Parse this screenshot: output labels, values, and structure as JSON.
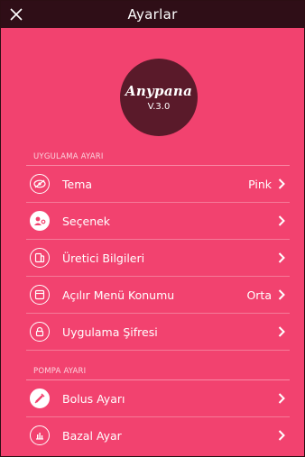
{
  "header": {
    "title": "Ayarlar"
  },
  "logo": {
    "brand": "Anypana",
    "version": "V.3.0"
  },
  "sections": [
    {
      "title": "UYGULAMA AYARI",
      "items": [
        {
          "label": "Tema",
          "value": "Pink",
          "icon": "eye-slash-icon"
        },
        {
          "label": "Seçenek",
          "value": "",
          "icon": "user-settings-icon"
        },
        {
          "label": "Üretici Bilgileri",
          "value": "",
          "icon": "device-info-icon"
        },
        {
          "label": "Açılır Menü Konumu",
          "value": "Orta",
          "icon": "window-icon"
        },
        {
          "label": "Uygulama Şifresi",
          "value": "",
          "icon": "lock-icon"
        }
      ]
    },
    {
      "title": "POMPA AYARI",
      "items": [
        {
          "label": "Bolus Ayarı",
          "value": "",
          "icon": "syringe-icon"
        },
        {
          "label": "Bazal Ayar",
          "value": "",
          "icon": "bar-chart-icon"
        }
      ]
    }
  ]
}
